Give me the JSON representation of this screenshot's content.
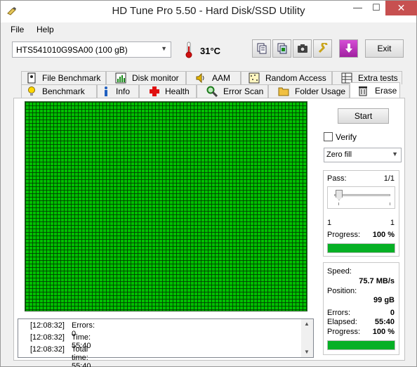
{
  "window": {
    "title": "HD Tune Pro 5.50 - Hard Disk/SSD Utility",
    "minimize": "—",
    "maximize": "☐",
    "close": "✕"
  },
  "menu": {
    "file": "File",
    "help": "Help"
  },
  "toolbar": {
    "drive": "HTS541010G9SA00 (100 gB)",
    "temperature": "31",
    "temperature_unit": "°C",
    "exit": "Exit"
  },
  "tabs": {
    "top": [
      "File Benchmark",
      "Disk monitor",
      "AAM",
      "Random Access",
      "Extra tests"
    ],
    "bottom": [
      "Benchmark",
      "Info",
      "Health",
      "Error Scan",
      "Folder Usage",
      "Erase"
    ],
    "active": "Erase"
  },
  "erase": {
    "start": "Start",
    "verify": "Verify",
    "verify_checked": false,
    "mode": "Zero fill",
    "pass_label": "Pass:",
    "pass_value": "1/1",
    "pass_min": "1",
    "pass_max": "1",
    "progress_label": "Progress:",
    "progress_value": "100 %",
    "progress_fraction": 1.0,
    "speed_label": "Speed:",
    "speed_value": "75.7 MB/s",
    "position_label": "Position:",
    "position_value": "99 gB",
    "errors_label": "Errors:",
    "errors_value": "0",
    "elapsed_label": "Elapsed:",
    "elapsed_value": "55:40",
    "progress2_label": "Progress:",
    "progress2_value": "100 %",
    "progress2_fraction": 1.0
  },
  "log": [
    {
      "time": "[12:08:32]",
      "msg": "Errors: 0"
    },
    {
      "time": "[12:08:32]",
      "msg": "Time: 55:40"
    },
    {
      "time": "[12:08:32]",
      "msg": "Total time: 55:40"
    }
  ],
  "colors": {
    "block_ok": "#00c000",
    "progress": "#06b025",
    "close_button": "#c75050"
  }
}
